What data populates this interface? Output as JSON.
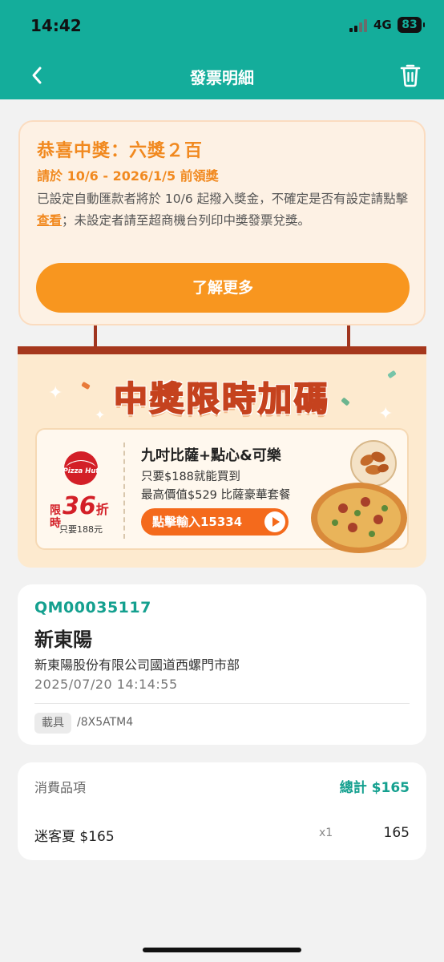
{
  "status_bar": {
    "time": "14:42",
    "network": "4G",
    "battery": "83"
  },
  "header": {
    "title": "發票明細"
  },
  "prize": {
    "title": "恭喜中獎：六獎２百",
    "deadline": "請於 10/6 - 2026/1/5 前領獎",
    "desc_before": "已設定自動匯款者將於 10/6 起撥入獎金，不確定是否有設定請點擊",
    "desc_link": "查看",
    "desc_after": "；未設定者請至超商機台列印中獎發票兌獎。",
    "button": "了解更多"
  },
  "promo": {
    "headline": "中獎限時加碼",
    "brand": "Pizza Hut",
    "limit_label": "限時",
    "discount": "36",
    "discount_unit": "折",
    "only_price": "只要188元",
    "title": "九吋比薩+點心&可樂",
    "line1": "只要$188就能買到",
    "line2": "最高價值$529 比薩豪華套餐",
    "button": "點擊輸入15334"
  },
  "invoice": {
    "number": "QM00035117",
    "store": "新東陽",
    "company": "新東陽股份有限公司國道西螺門市部",
    "datetime": "2025/07/20 14:14:55",
    "carrier_label": "載具",
    "carrier_value": "/8X5ATM4"
  },
  "items": {
    "label": "消費品項",
    "total": "總計 $165",
    "list": [
      {
        "name": "迷客夏 $165",
        "qty": "x1",
        "price": "165"
      }
    ]
  },
  "colors": {
    "header": "#14ad9b",
    "accent": "#f8961f",
    "teal_text": "#14a08f",
    "promo_red": "#c5421e"
  }
}
